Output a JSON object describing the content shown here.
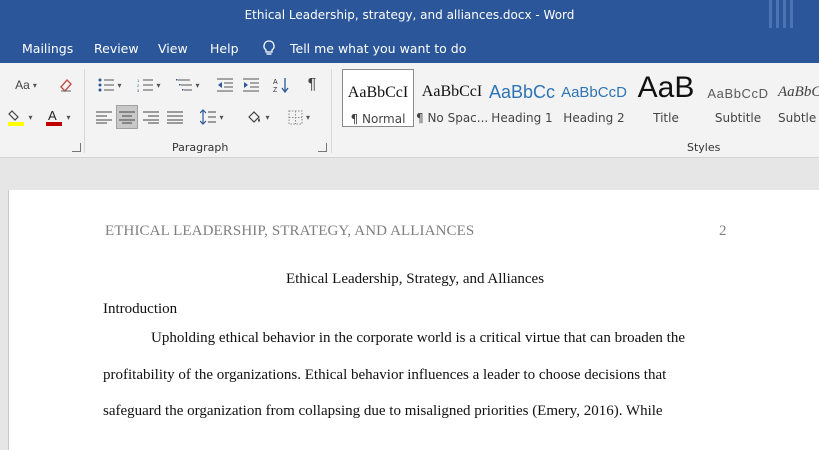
{
  "window": {
    "title": "Ethical Leadership, strategy, and alliances.docx  -  Word"
  },
  "menu": {
    "mailings": "Mailings",
    "review": "Review",
    "view": "View",
    "help": "Help",
    "tell_me": "Tell me what you want to do"
  },
  "ribbon": {
    "font_aa_label": "Aa",
    "paragraph_label": "Paragraph",
    "styles_label": "Styles",
    "styles": [
      {
        "preview": "AaBbCcI",
        "name": "¶ Normal"
      },
      {
        "preview": "AaBbCcI",
        "name": "¶ No Spac..."
      },
      {
        "preview": "AaBbCc",
        "name": "Heading 1"
      },
      {
        "preview": "AaBbCcD",
        "name": "Heading 2"
      },
      {
        "preview": "AaB",
        "name": "Title"
      },
      {
        "preview": "AaBbCcD",
        "name": "Subtitle"
      },
      {
        "preview": "AaBbC",
        "name": "Subtle E"
      }
    ]
  },
  "colors": {
    "accent": "#2b579a",
    "highlight": "#ffff00",
    "font_color": "#c00000",
    "heading_style": "#2e74b5"
  },
  "document": {
    "header": "ETHICAL LEADERSHIP, STRATEGY, AND ALLIANCES",
    "page_number": "2",
    "title": "Ethical Leadership, Strategy, and Alliances",
    "heading": "Introduction",
    "lines": [
      "Upholding ethical behavior in the corporate world is a critical virtue that can broaden the",
      "profitability of the organizations. Ethical behavior influences a leader to choose decisions that",
      "safeguard the organization from collapsing due to misaligned priorities (Emery, 2016). While"
    ]
  }
}
